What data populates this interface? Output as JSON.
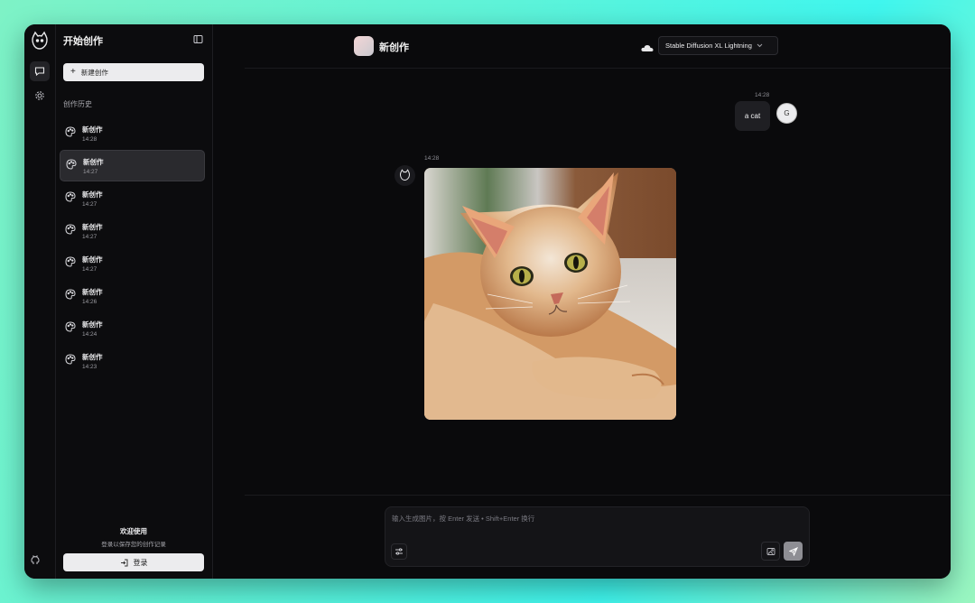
{
  "sidebar": {
    "title": "开始创作",
    "new_button": "新建创作",
    "history_label": "创作历史",
    "items": [
      {
        "title": "新创作",
        "time": "14:28"
      },
      {
        "title": "新创作",
        "time": "14:27"
      },
      {
        "title": "新创作",
        "time": "14:27"
      },
      {
        "title": "新创作",
        "time": "14:27"
      },
      {
        "title": "新创作",
        "time": "14:27"
      },
      {
        "title": "新创作",
        "time": "14:26"
      },
      {
        "title": "新创作",
        "time": "14:24"
      },
      {
        "title": "新创作",
        "time": "14:23"
      }
    ],
    "selected_index": 1,
    "welcome": "欢迎使用",
    "welcome_sub": "登录以保存您的创作记录",
    "login_button": "登录"
  },
  "header": {
    "title": "新创作",
    "model": "Stable Diffusion XL Lightning"
  },
  "chat": {
    "user_message": {
      "time": "14:28",
      "text": "a cat",
      "avatar_letter": "G"
    },
    "bot_message": {
      "time": "14:28"
    }
  },
  "composer": {
    "placeholder": "输入生成图片，按 Enter 发送 • Shift+Enter 换行"
  },
  "colors": {
    "window_bg": "#0a0a0c",
    "sidebar_bg": "#0c0c0e",
    "selected_item_bg": "#2a2a2e",
    "button_bg": "#ececee"
  }
}
